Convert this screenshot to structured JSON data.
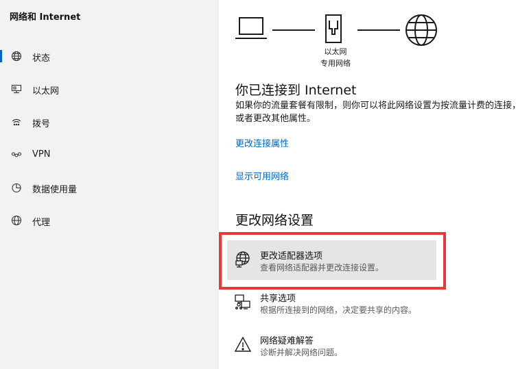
{
  "sidebar": {
    "title": "网络和 Internet",
    "items": [
      {
        "label": "状态",
        "icon": "globe-icon",
        "selected": true
      },
      {
        "label": "以太网",
        "icon": "ethernet-icon",
        "selected": false
      },
      {
        "label": "拨号",
        "icon": "dialup-icon",
        "selected": false
      },
      {
        "label": "VPN",
        "icon": "vpn-icon",
        "selected": false
      },
      {
        "label": "数据使用量",
        "icon": "data-usage-icon",
        "selected": false
      },
      {
        "label": "代理",
        "icon": "proxy-globe-icon",
        "selected": false
      }
    ]
  },
  "status": {
    "diagram": {
      "label_line1": "以太网",
      "label_line2": "专用网络"
    },
    "heading": "你已连接到 Internet",
    "description": "如果你的流量套餐有限制，则你可以将此网络设置为按流量计费的连接，或者更改其他属性。",
    "link_change_properties": "更改连接属性",
    "link_show_networks": "显示可用网络"
  },
  "advanced": {
    "heading": "更改网络设置",
    "options": [
      {
        "title": "更改适配器选项",
        "subtitle": "查看网络适配器并更改连接设置。",
        "icon": "adapter-globe-icon",
        "hovered": true
      },
      {
        "title": "共享选项",
        "subtitle": "根据所连接到的网络，决定要共享的内容。",
        "icon": "sharing-icon",
        "hovered": false
      },
      {
        "title": "网络疑难解答",
        "subtitle": "诊断并解决网络问题。",
        "icon": "warning-icon",
        "hovered": false
      }
    ]
  },
  "colors": {
    "accent": "#0067c0",
    "sidebar_bg": "#f2f2f2",
    "highlight_border": "#e8383a",
    "hover_bg": "#e5e5e5"
  }
}
